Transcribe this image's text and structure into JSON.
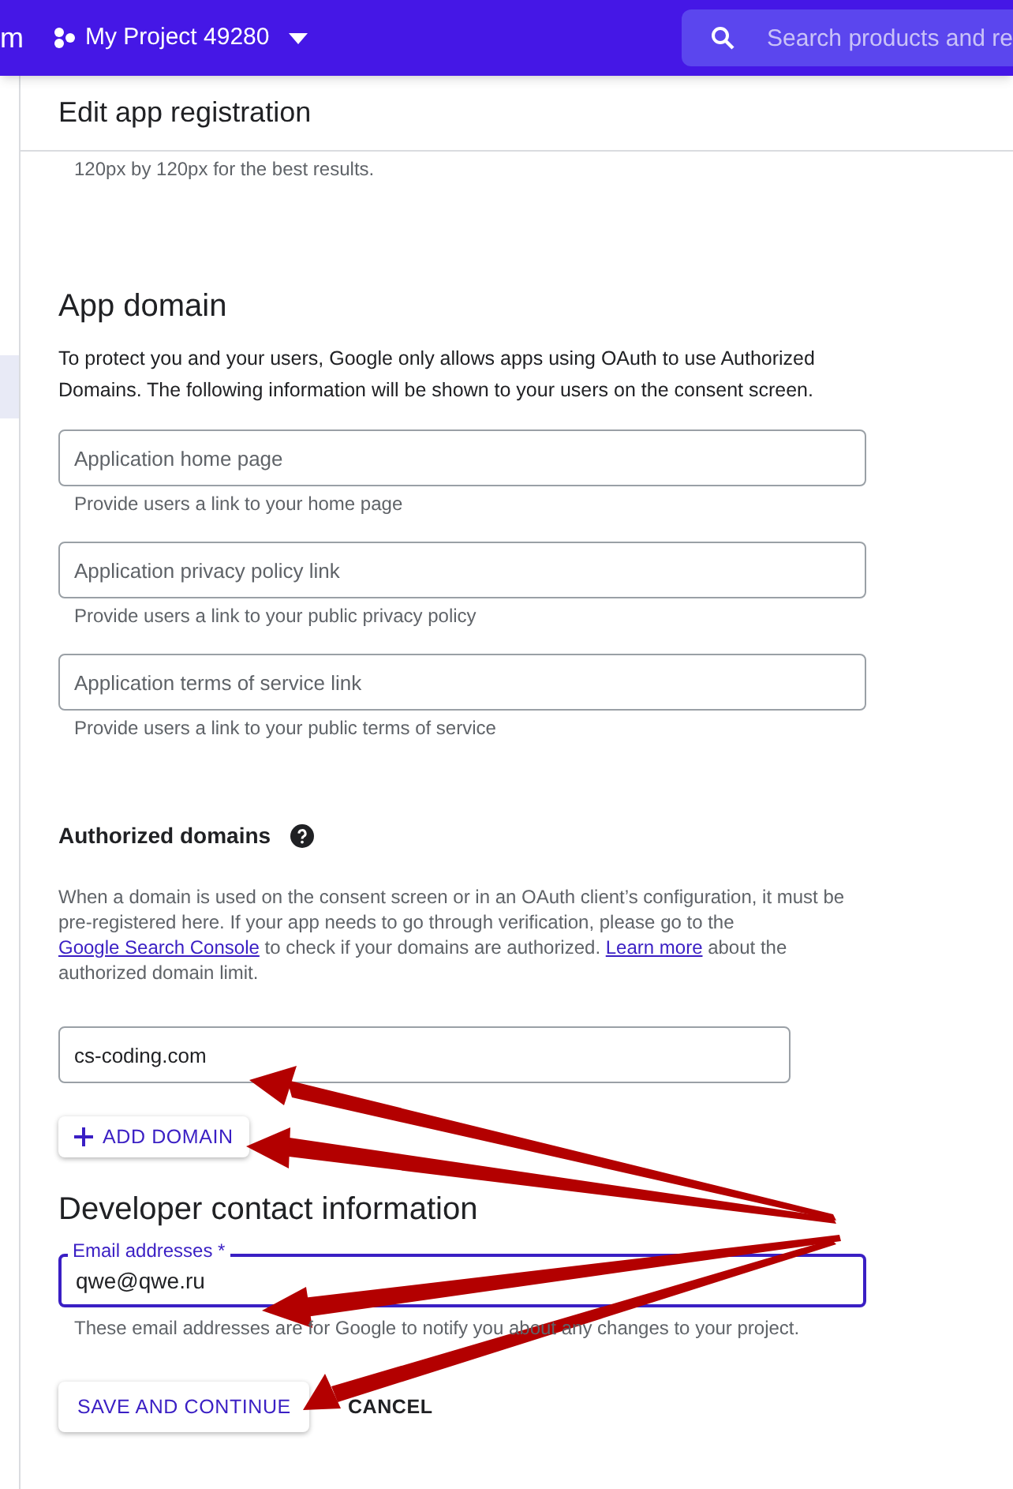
{
  "top_bar": {
    "brand_fragment": "m",
    "project": "My Project 49280",
    "search": {
      "placeholder": "Search products and re"
    }
  },
  "page_title": "Edit app registration",
  "logo_hint_tail": "120px by 120px for the best results.",
  "app_domain": {
    "heading": "App domain",
    "description": "To protect you and your users, Google only allows apps using OAuth to use Authorized Domains. The following information will be shown to your users on the consent screen.",
    "fields": [
      {
        "placeholder": "Application home page",
        "hint": "Provide users a link to your home page"
      },
      {
        "placeholder": "Application privacy policy link",
        "hint": "Provide users a link to your public privacy policy"
      },
      {
        "placeholder": "Application terms of service link",
        "hint": "Provide users a link to your public terms of service"
      }
    ]
  },
  "authorized_domains": {
    "heading": "Authorized domains",
    "text_parts": [
      "When a domain is used on the consent screen or in an OAuth client’s configuration, it must be pre-registered here. If your app needs to go through verification, please go to the ",
      "Google Search Console",
      " to check if your domains are authorized. ",
      "Learn more",
      " about the authorized domain limit."
    ],
    "domains": [
      {
        "value": "cs-coding.com"
      }
    ],
    "add_button": "ADD DOMAIN"
  },
  "developer_contact": {
    "heading": "Developer contact information",
    "email": {
      "label": "Email addresses *",
      "value": "qwe@qwe.ru",
      "focused": true
    },
    "hint": "These email addresses are for Google to notify you about any changes to your project."
  },
  "actions": [
    {
      "label": "SAVE AND CONTINUE",
      "kind": "raised"
    },
    {
      "label": "CANCEL",
      "kind": "flat"
    }
  ]
}
